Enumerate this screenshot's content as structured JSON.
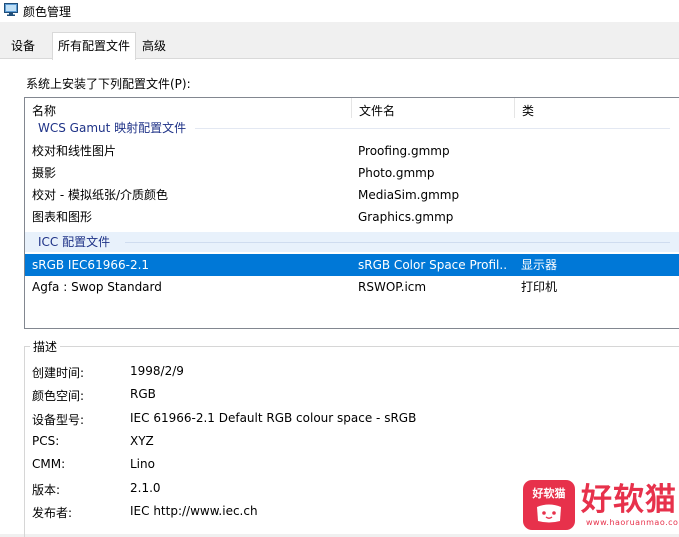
{
  "window": {
    "title": "颜色管理",
    "icon": "monitor-icon"
  },
  "tabs": [
    {
      "label": "设备",
      "selected": false
    },
    {
      "label": "所有配置文件",
      "selected": true
    },
    {
      "label": "高级",
      "selected": false
    }
  ],
  "profiles": {
    "caption": "系统上安装了下列配置文件(P):",
    "columns": [
      "名称",
      "文件名",
      "类"
    ],
    "groups": [
      {
        "label": "WCS Gamut 映射配置文件",
        "rows": [
          {
            "name": "校对和线性图片",
            "file": "Proofing.gmmp",
            "class": ""
          },
          {
            "name": "摄影",
            "file": "Photo.gmmp",
            "class": ""
          },
          {
            "name": "校对 - 模拟纸张/介质颜色",
            "file": "MediaSim.gmmp",
            "class": ""
          },
          {
            "name": "图表和图形",
            "file": "Graphics.gmmp",
            "class": ""
          }
        ]
      },
      {
        "label": "ICC 配置文件",
        "rows": [
          {
            "name": "sRGB IEC61966-2.1",
            "file": "sRGB Color Space Profil...",
            "class": "显示器",
            "selected": true
          },
          {
            "name": "Agfa : Swop Standard",
            "file": "RSWOP.icm",
            "class": "打印机"
          }
        ]
      }
    ]
  },
  "description": {
    "title": "描述",
    "fields": [
      {
        "label": "创建时间:",
        "value": "1998/2/9"
      },
      {
        "label": "颜色空间:",
        "value": "RGB"
      },
      {
        "label": "设备型号:",
        "value": "IEC 61966-2.1 Default RGB colour space - sRGB"
      },
      {
        "label": "PCS:",
        "value": "XYZ"
      },
      {
        "label": "CMM:",
        "value": "Lino"
      },
      {
        "label": "版本:",
        "value": "2.1.0"
      },
      {
        "label": "发布者:",
        "value": "IEC http://www.iec.ch"
      }
    ]
  },
  "watermark": {
    "badge_text": "好软猫",
    "brand_text": "好软猫",
    "url": "www.haoruanmao.com",
    "color": "#e7314b"
  },
  "colors": {
    "selection": "#0078d7",
    "group_header": "#1e3287"
  }
}
